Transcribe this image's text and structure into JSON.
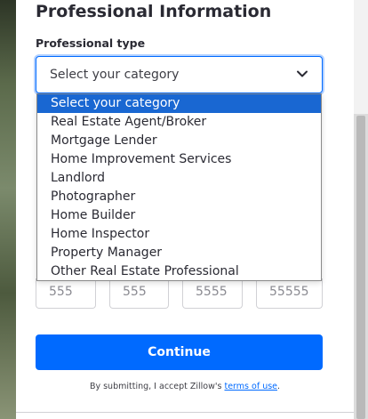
{
  "form": {
    "section_title": "Professional Information",
    "professional_type_label": "Professional type",
    "selected_value": "Select your category",
    "options": [
      "Select your category",
      "Real Estate Agent/Broker",
      "Mortgage Lender",
      "Home Improvement Services",
      "Landlord",
      "Photographer",
      "Home Builder",
      "Home Inspector",
      "Property Manager",
      "Other Real Estate Professional"
    ],
    "phone_placeholders": [
      "555",
      "555",
      "5555",
      "55555"
    ],
    "continue_label": "Continue",
    "disclaimer_prefix": "By submitting, I accept Zillow's",
    "terms_link": "terms of use",
    "disclaimer_suffix": "."
  },
  "colors": {
    "accent": "#006aff",
    "selected_option": "#1967d2",
    "heading": "#2a2a33"
  },
  "icons": {
    "select": "chevron-down-icon"
  }
}
